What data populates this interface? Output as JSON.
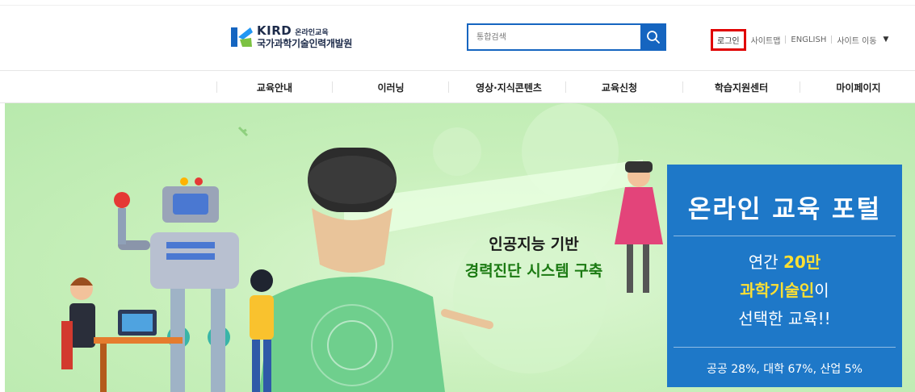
{
  "header": {
    "logo": {
      "brand": "KIRD",
      "sub": "온라인교육",
      "name": "국가과학기술인력개발원"
    },
    "search": {
      "placeholder": "통합검색",
      "icon": "search-icon"
    },
    "util": {
      "login": "로그인",
      "sitemap": "사이트맵",
      "english": "ENGLISH",
      "site_move": "사이트 이동",
      "site_move_icon": "triangle-down-icon"
    }
  },
  "nav": {
    "items": [
      {
        "label": "교육안내"
      },
      {
        "label": "이러닝"
      },
      {
        "label": "영상·지식콘텐츠"
      },
      {
        "label": "교육신청"
      },
      {
        "label": "학습지원센터"
      },
      {
        "label": "마이페이지"
      }
    ]
  },
  "hero": {
    "line1": "인공지능 기반",
    "line2": "경력진단 시스템 구축",
    "portal": {
      "title": "온라인 교육 포털",
      "l1_pre": "연간 ",
      "l1_highlight": "20만",
      "l2_highlight": "과학기술인",
      "l2_post": "이",
      "l3": "선택한 교육!!",
      "stats": "공공 28%, 대학 67%, 산업 5%"
    }
  },
  "colors": {
    "accent_blue": "#1565c0",
    "portal_blue": "#1e78c8",
    "highlight_yellow": "#ffe033",
    "login_outline": "#e00000",
    "hero_green": "#c9f0bc",
    "headline_green": "#1b7a12"
  }
}
